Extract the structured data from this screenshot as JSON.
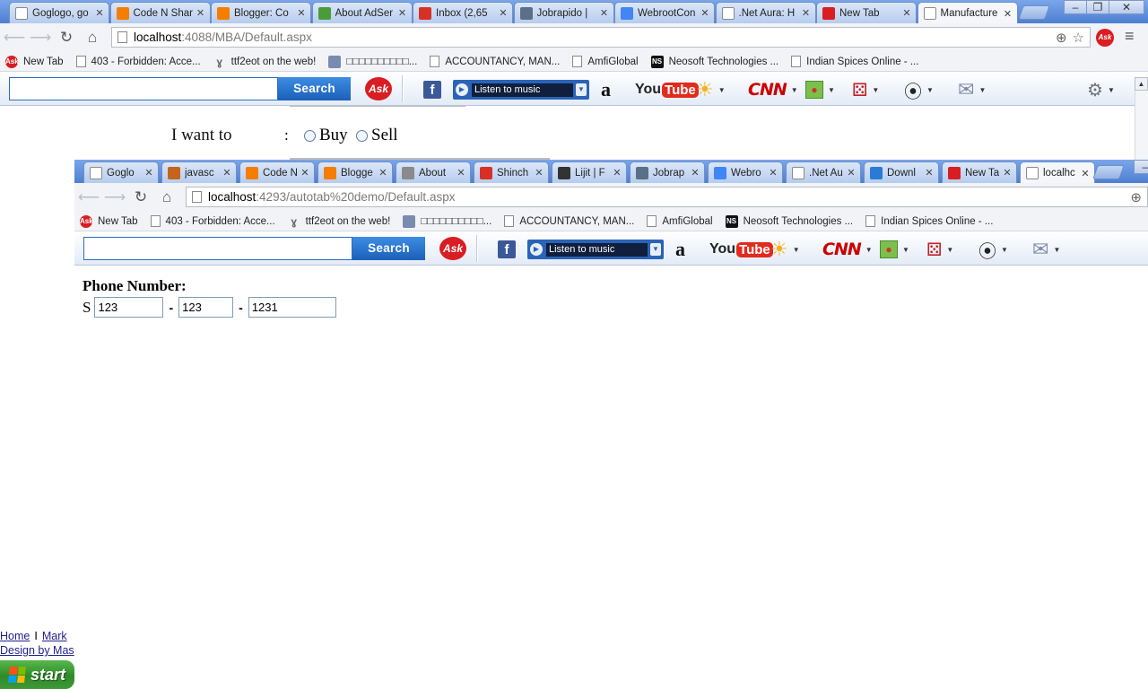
{
  "outer": {
    "tabs": [
      {
        "label": "Goglogo, go",
        "icon": "page-icon",
        "icon_color": "#ffffff"
      },
      {
        "label": "Code N Shar",
        "icon": "blogger-icon",
        "icon_color": "#f57d00"
      },
      {
        "label": "Blogger: Co",
        "icon": "blogger-icon",
        "icon_color": "#f57d00"
      },
      {
        "label": "About AdSer",
        "icon": "adsense-icon",
        "icon_color": "#4a9c3a"
      },
      {
        "label": "Inbox (2,65",
        "icon": "gmail-icon",
        "icon_color": "#d93025"
      },
      {
        "label": "Jobrapido |",
        "icon": "jobrapido-icon",
        "icon_color": "#5b6f86"
      },
      {
        "label": "WebrootCon",
        "icon": "google-icon",
        "icon_color": "#4285f4"
      },
      {
        "label": ".Net Aura: H",
        "icon": "net-icon",
        "icon_color": "#ffffff"
      },
      {
        "label": "New Tab",
        "icon": "ask-icon",
        "icon_color": "#d91d22"
      },
      {
        "label": "Manufacture",
        "icon": "page-icon",
        "icon_color": "#ffffff",
        "active": true
      }
    ],
    "url_host": "localhost",
    "url_path": ":4088/MBA/Default.aspx",
    "bookmarks": [
      {
        "label": "New Tab",
        "icon": "ask"
      },
      {
        "label": "403 - Forbidden: Acce...",
        "icon": "doc"
      },
      {
        "label": "ttf2eot on the web!",
        "icon": "y"
      },
      {
        "label": "□□□□□□□□□□...",
        "icon": "img"
      },
      {
        "label": "ACCOUNTANCY, MAN...",
        "icon": "doc"
      },
      {
        "label": "AmfiGlobal",
        "icon": "doc"
      },
      {
        "label": "Neosoft Technologies ...",
        "icon": "ns"
      },
      {
        "label": "Indian Spices Online - ...",
        "icon": "doc"
      }
    ],
    "search_label": "Search",
    "music_label": "Listen to music",
    "want_label": "I want to",
    "colon": ":",
    "buy_label": "Buy",
    "sell_label": "Sell",
    "footer_home": "Home",
    "footer_pipe": "I",
    "footer_mark": "Mark",
    "footer_design": "Design by Mas"
  },
  "inner": {
    "tabs": [
      {
        "label": "Goglo",
        "icon": "page-icon",
        "icon_color": "#ffffff"
      },
      {
        "label": "javasc",
        "icon": "java-icon",
        "icon_color": "#c5641d"
      },
      {
        "label": "Code N",
        "icon": "blogger-icon",
        "icon_color": "#f57d00"
      },
      {
        "label": "Blogge",
        "icon": "blogger-icon",
        "icon_color": "#f57d00"
      },
      {
        "label": "About",
        "icon": "image-icon",
        "icon_color": "#8a8a8a"
      },
      {
        "label": "Shinch",
        "icon": "gmail-icon",
        "icon_color": "#d93025"
      },
      {
        "label": "Lijit | F",
        "icon": "binoculars-icon",
        "icon_color": "#333333"
      },
      {
        "label": "Jobrap",
        "icon": "jobrapido-icon",
        "icon_color": "#5b6f86"
      },
      {
        "label": "Webro",
        "icon": "google-icon",
        "icon_color": "#4285f4"
      },
      {
        "label": ".Net Au",
        "icon": "net-icon",
        "icon_color": "#ffffff"
      },
      {
        "label": "Downl",
        "icon": "download-icon",
        "icon_color": "#2a7bd5"
      },
      {
        "label": "New Ta",
        "icon": "ask-icon",
        "icon_color": "#d91d22"
      },
      {
        "label": "localhc",
        "icon": "page-icon",
        "icon_color": "#ffffff",
        "active": true
      }
    ],
    "url_host": "localhost",
    "url_path": ":4293/autotab%20demo/Default.aspx",
    "bookmarks": [
      {
        "label": "New Tab",
        "icon": "ask"
      },
      {
        "label": "403 - Forbidden: Acce...",
        "icon": "doc"
      },
      {
        "label": "ttf2eot on the web!",
        "icon": "y"
      },
      {
        "label": "□□□□□□□□□□...",
        "icon": "img"
      },
      {
        "label": "ACCOUNTANCY, MAN...",
        "icon": "doc"
      },
      {
        "label": "AmfiGlobal",
        "icon": "doc"
      },
      {
        "label": "Neosoft Technologies ...",
        "icon": "ns"
      },
      {
        "label": "Indian Spices Online - ...",
        "icon": "doc"
      }
    ],
    "search_label": "Search",
    "music_label": "Listen to music",
    "phone_title": "Phone Number:",
    "phone_prefix": "S",
    "phone_part1": "123",
    "phone_part2": "123",
    "phone_part3": "1231",
    "dash": "-"
  },
  "taskbar": {
    "start_label": "start"
  },
  "toolbar_icons": {
    "facebook": "f",
    "amazon": "a",
    "youtube_you": "You",
    "youtube_tube": "Tube",
    "cnn": "CNN",
    "ask": "Ask"
  },
  "colors": {
    "ask_red": "#d91d22",
    "search_blue": "#1b5fb8",
    "link": "#1d1d8e",
    "start_green": "#2f8a2a"
  }
}
